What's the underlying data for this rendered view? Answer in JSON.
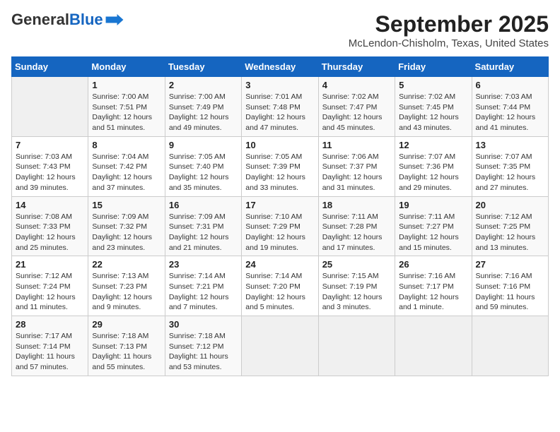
{
  "header": {
    "logo_line1": "General",
    "logo_line2": "Blue",
    "month": "September 2025",
    "location": "McLendon-Chisholm, Texas, United States"
  },
  "weekdays": [
    "Sunday",
    "Monday",
    "Tuesday",
    "Wednesday",
    "Thursday",
    "Friday",
    "Saturday"
  ],
  "weeks": [
    [
      {
        "day": "",
        "info": ""
      },
      {
        "day": "1",
        "info": "Sunrise: 7:00 AM\nSunset: 7:51 PM\nDaylight: 12 hours\nand 51 minutes."
      },
      {
        "day": "2",
        "info": "Sunrise: 7:00 AM\nSunset: 7:49 PM\nDaylight: 12 hours\nand 49 minutes."
      },
      {
        "day": "3",
        "info": "Sunrise: 7:01 AM\nSunset: 7:48 PM\nDaylight: 12 hours\nand 47 minutes."
      },
      {
        "day": "4",
        "info": "Sunrise: 7:02 AM\nSunset: 7:47 PM\nDaylight: 12 hours\nand 45 minutes."
      },
      {
        "day": "5",
        "info": "Sunrise: 7:02 AM\nSunset: 7:45 PM\nDaylight: 12 hours\nand 43 minutes."
      },
      {
        "day": "6",
        "info": "Sunrise: 7:03 AM\nSunset: 7:44 PM\nDaylight: 12 hours\nand 41 minutes."
      }
    ],
    [
      {
        "day": "7",
        "info": "Sunrise: 7:03 AM\nSunset: 7:43 PM\nDaylight: 12 hours\nand 39 minutes."
      },
      {
        "day": "8",
        "info": "Sunrise: 7:04 AM\nSunset: 7:42 PM\nDaylight: 12 hours\nand 37 minutes."
      },
      {
        "day": "9",
        "info": "Sunrise: 7:05 AM\nSunset: 7:40 PM\nDaylight: 12 hours\nand 35 minutes."
      },
      {
        "day": "10",
        "info": "Sunrise: 7:05 AM\nSunset: 7:39 PM\nDaylight: 12 hours\nand 33 minutes."
      },
      {
        "day": "11",
        "info": "Sunrise: 7:06 AM\nSunset: 7:37 PM\nDaylight: 12 hours\nand 31 minutes."
      },
      {
        "day": "12",
        "info": "Sunrise: 7:07 AM\nSunset: 7:36 PM\nDaylight: 12 hours\nand 29 minutes."
      },
      {
        "day": "13",
        "info": "Sunrise: 7:07 AM\nSunset: 7:35 PM\nDaylight: 12 hours\nand 27 minutes."
      }
    ],
    [
      {
        "day": "14",
        "info": "Sunrise: 7:08 AM\nSunset: 7:33 PM\nDaylight: 12 hours\nand 25 minutes."
      },
      {
        "day": "15",
        "info": "Sunrise: 7:09 AM\nSunset: 7:32 PM\nDaylight: 12 hours\nand 23 minutes."
      },
      {
        "day": "16",
        "info": "Sunrise: 7:09 AM\nSunset: 7:31 PM\nDaylight: 12 hours\nand 21 minutes."
      },
      {
        "day": "17",
        "info": "Sunrise: 7:10 AM\nSunset: 7:29 PM\nDaylight: 12 hours\nand 19 minutes."
      },
      {
        "day": "18",
        "info": "Sunrise: 7:11 AM\nSunset: 7:28 PM\nDaylight: 12 hours\nand 17 minutes."
      },
      {
        "day": "19",
        "info": "Sunrise: 7:11 AM\nSunset: 7:27 PM\nDaylight: 12 hours\nand 15 minutes."
      },
      {
        "day": "20",
        "info": "Sunrise: 7:12 AM\nSunset: 7:25 PM\nDaylight: 12 hours\nand 13 minutes."
      }
    ],
    [
      {
        "day": "21",
        "info": "Sunrise: 7:12 AM\nSunset: 7:24 PM\nDaylight: 12 hours\nand 11 minutes."
      },
      {
        "day": "22",
        "info": "Sunrise: 7:13 AM\nSunset: 7:23 PM\nDaylight: 12 hours\nand 9 minutes."
      },
      {
        "day": "23",
        "info": "Sunrise: 7:14 AM\nSunset: 7:21 PM\nDaylight: 12 hours\nand 7 minutes."
      },
      {
        "day": "24",
        "info": "Sunrise: 7:14 AM\nSunset: 7:20 PM\nDaylight: 12 hours\nand 5 minutes."
      },
      {
        "day": "25",
        "info": "Sunrise: 7:15 AM\nSunset: 7:19 PM\nDaylight: 12 hours\nand 3 minutes."
      },
      {
        "day": "26",
        "info": "Sunrise: 7:16 AM\nSunset: 7:17 PM\nDaylight: 12 hours\nand 1 minute."
      },
      {
        "day": "27",
        "info": "Sunrise: 7:16 AM\nSunset: 7:16 PM\nDaylight: 11 hours\nand 59 minutes."
      }
    ],
    [
      {
        "day": "28",
        "info": "Sunrise: 7:17 AM\nSunset: 7:14 PM\nDaylight: 11 hours\nand 57 minutes."
      },
      {
        "day": "29",
        "info": "Sunrise: 7:18 AM\nSunset: 7:13 PM\nDaylight: 11 hours\nand 55 minutes."
      },
      {
        "day": "30",
        "info": "Sunrise: 7:18 AM\nSunset: 7:12 PM\nDaylight: 11 hours\nand 53 minutes."
      },
      {
        "day": "",
        "info": ""
      },
      {
        "day": "",
        "info": ""
      },
      {
        "day": "",
        "info": ""
      },
      {
        "day": "",
        "info": ""
      }
    ]
  ]
}
